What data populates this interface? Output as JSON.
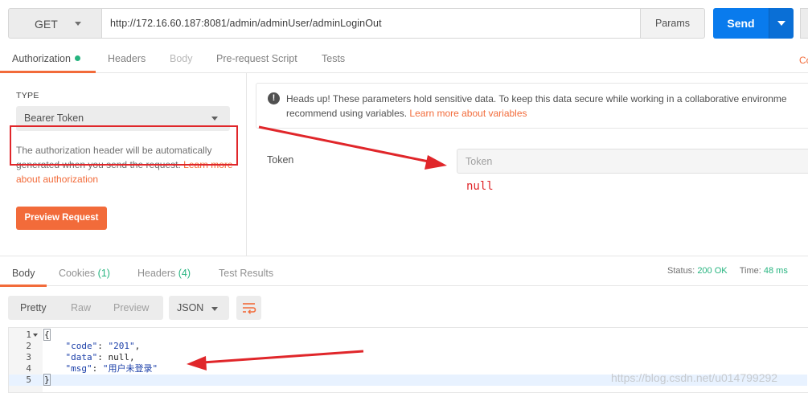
{
  "request": {
    "method": "GET",
    "url": "http://172.16.60.187:8081/admin/adminUser/adminLoginOut",
    "params_label": "Params",
    "send_label": "Send"
  },
  "request_tabs": {
    "authorization": "Authorization",
    "headers": "Headers",
    "body": "Body",
    "prerequest": "Pre-request Script",
    "tests": "Tests",
    "cookies_partial": "Co"
  },
  "auth": {
    "type_label": "TYPE",
    "type_value": "Bearer Token",
    "desc_before": "The authorization header will be automatically generated when you send the request.",
    "desc_link": "Learn more about authorization",
    "preview_button": "Preview Request",
    "notice_line1": "Heads up! These parameters hold sensitive data. To keep this data secure while working in a collaborative environme",
    "notice_line2_before": "recommend using variables.",
    "notice_link": "Learn more about variables",
    "token_label": "Token",
    "token_placeholder": "Token",
    "annotation_null": "null"
  },
  "response_tabs": {
    "body": "Body",
    "cookies": "Cookies",
    "cookies_count": "(1)",
    "headers": "Headers",
    "headers_count": "(4)",
    "test_results": "Test Results",
    "status_label": "Status:",
    "status_value": "200 OK",
    "time_label": "Time:",
    "time_value": "48 ms"
  },
  "view": {
    "pretty": "Pretty",
    "raw": "Raw",
    "preview": "Preview",
    "format": "JSON"
  },
  "code": {
    "lines": [
      {
        "n": "1",
        "text": "{"
      },
      {
        "n": "2",
        "key": "\"code\"",
        "value": "\"201\"",
        "trail": ","
      },
      {
        "n": "3",
        "key": "\"data\"",
        "value": "null",
        "trail": ","
      },
      {
        "n": "4",
        "key": "\"msg\"",
        "value": "\"用户未登录\"",
        "trail": ""
      },
      {
        "n": "5",
        "text": "}"
      }
    ]
  },
  "watermark": "https://blog.csdn.net/u014799292",
  "colors": {
    "accent": "#f26b3a",
    "send": "#097bed",
    "success": "#26b47f",
    "annotation": "#e0262a"
  }
}
